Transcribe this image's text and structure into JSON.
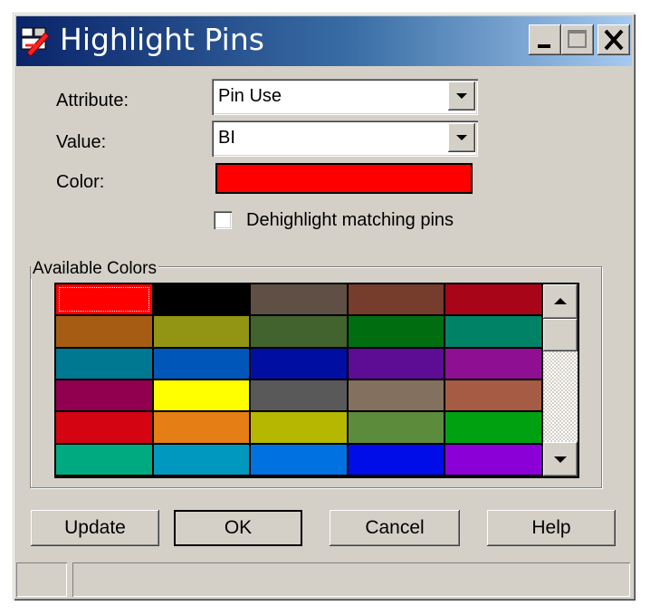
{
  "window": {
    "title": "Highlight Pins",
    "icon": "highlight-pins-app-icon",
    "controls": [
      "minimize-icon",
      "maximize-icon",
      "close-icon"
    ]
  },
  "form": {
    "attribute_label": "Attribute:",
    "attribute_value": "Pin Use",
    "value_label": "Value:",
    "value_value": "BI",
    "color_label": "Color:",
    "color_value": "#ff0000",
    "dehighlight_label": "Dehighlight matching pins",
    "dehighlight_checked": false
  },
  "available_colors": {
    "label": "Available Colors",
    "selected_index": 0,
    "swatches": [
      "#ff0000",
      "#000000",
      "#5f4f44",
      "#763c2c",
      "#a80518",
      "#a65c12",
      "#929413",
      "#42622e",
      "#006e10",
      "#008266",
      "#017891",
      "#0156ba",
      "#000fa2",
      "#5d0c94",
      "#8f0f92",
      "#90004e",
      "#ffff00",
      "#595959",
      "#84705e",
      "#a65c44",
      "#d50412",
      "#e57e14",
      "#b5b700",
      "#5c8b3b",
      "#00a110",
      "#00aa80",
      "#0098bf",
      "#0071e1",
      "#000de8",
      "#8a00d6"
    ]
  },
  "buttons": {
    "update": "Update",
    "ok": "OK",
    "cancel": "Cancel",
    "help": "Help"
  },
  "status_bar": {
    "panes": [
      "",
      ""
    ]
  }
}
